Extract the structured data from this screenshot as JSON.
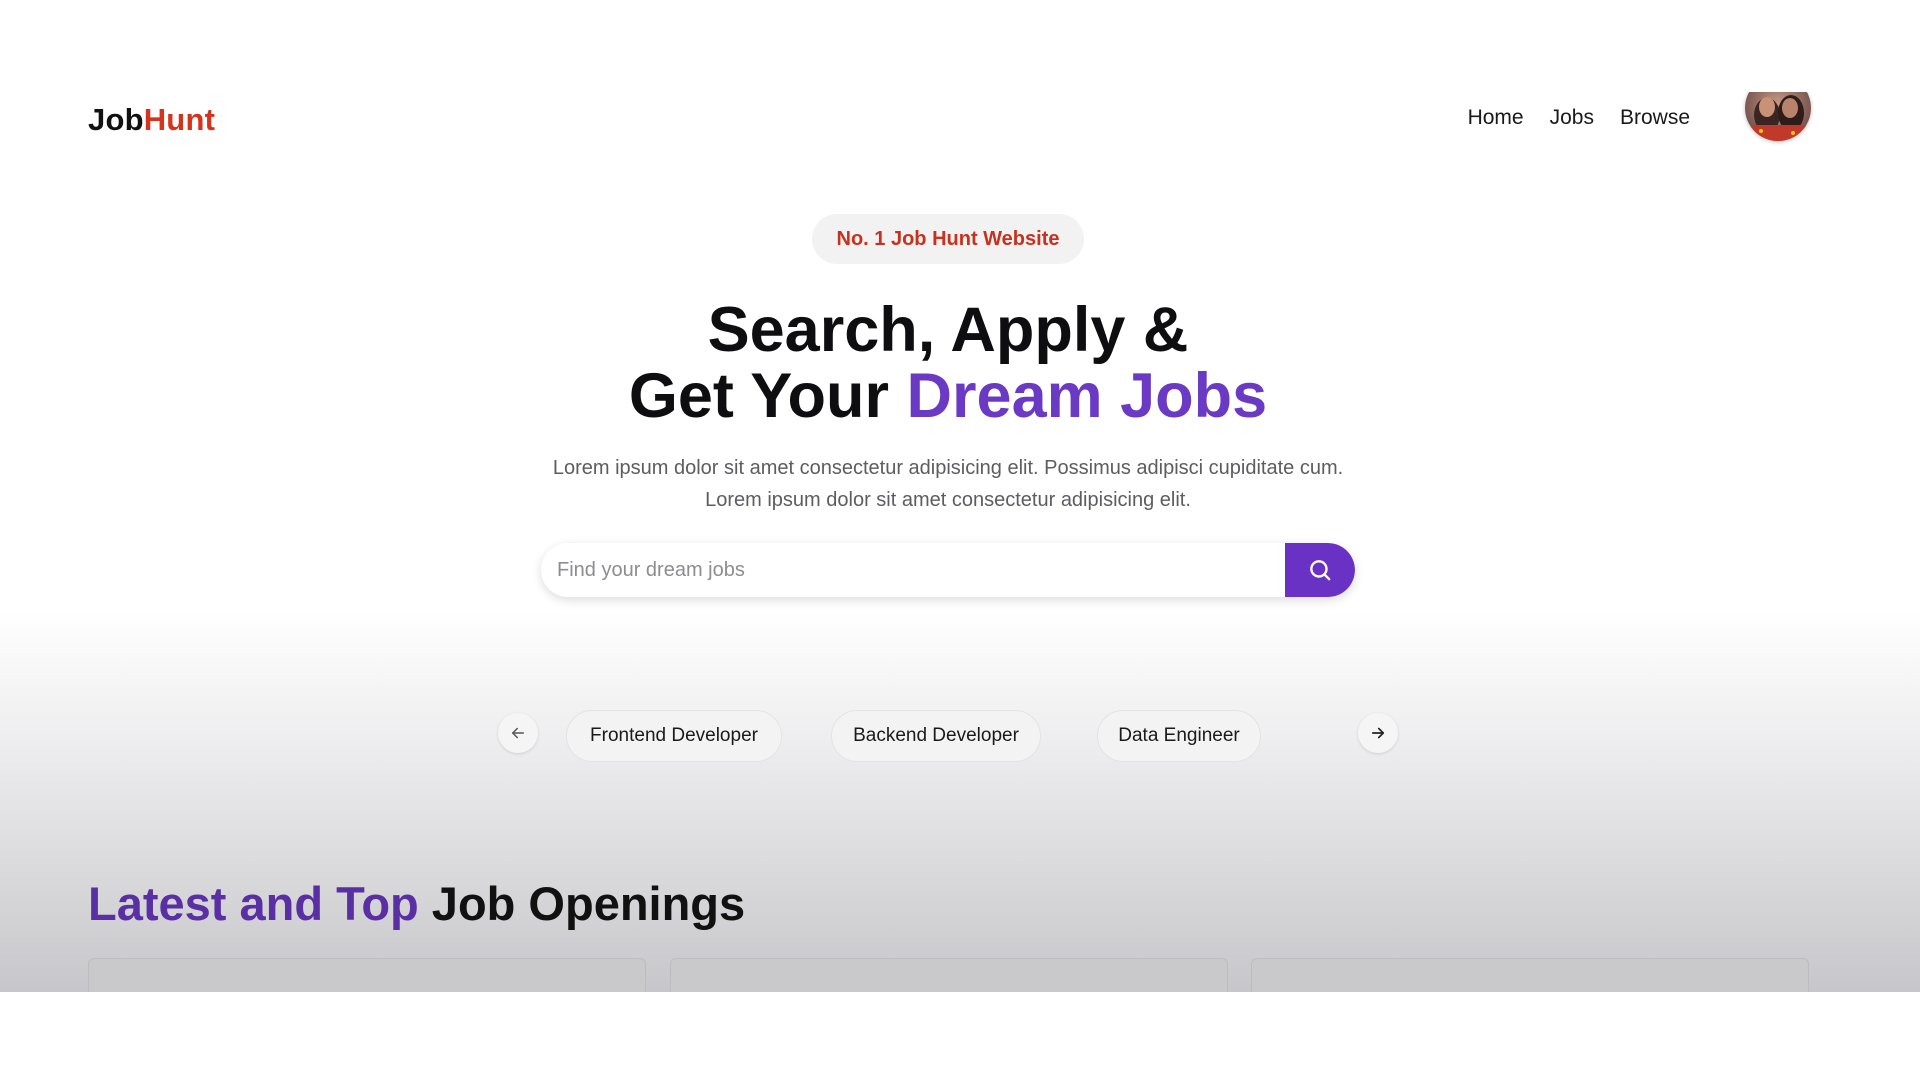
{
  "brand": {
    "part1": "Job",
    "part2": "Hunt",
    "accent_color": "#d6331f"
  },
  "nav": {
    "items": [
      {
        "label": "Home"
      },
      {
        "label": "Jobs"
      },
      {
        "label": "Browse"
      }
    ],
    "avatar_icon": "user-avatar"
  },
  "hero": {
    "badge": "No. 1 Job Hunt Website",
    "title_line1": "Search, Apply &",
    "title_line2_plain": "Get Your ",
    "title_line2_accent": "Dream Jobs",
    "subtitle_line1": "Lorem ipsum dolor sit amet consectetur adipisicing elit. Possimus adipisci cupiditate cum.",
    "subtitle_line2": "Lorem ipsum dolor sit amet consectetur adipisicing elit.",
    "accent_color": "#6a3ac4"
  },
  "search": {
    "placeholder": "Find your dream jobs",
    "value": "",
    "button_icon": "search-icon",
    "button_color": "#6a32c4"
  },
  "categories": {
    "prev_icon": "arrow-left-icon",
    "next_icon": "arrow-right-icon",
    "items": [
      {
        "label": "Frontend Developer"
      },
      {
        "label": "Backend Developer"
      },
      {
        "label": "Data Engineer"
      }
    ]
  },
  "latest": {
    "title_accent": "Latest and Top",
    "title_plain": " Job Openings"
  }
}
